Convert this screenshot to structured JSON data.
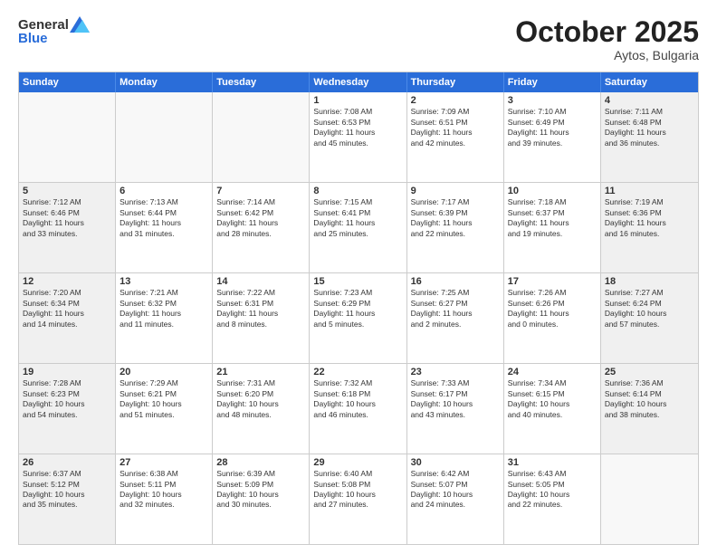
{
  "header": {
    "logo_general": "General",
    "logo_blue": "Blue",
    "month_title": "October 2025",
    "location": "Aytos, Bulgaria"
  },
  "days_of_week": [
    "Sunday",
    "Monday",
    "Tuesday",
    "Wednesday",
    "Thursday",
    "Friday",
    "Saturday"
  ],
  "weeks": [
    [
      {
        "day": "",
        "text": "",
        "empty": true
      },
      {
        "day": "",
        "text": "",
        "empty": true
      },
      {
        "day": "",
        "text": "",
        "empty": true
      },
      {
        "day": "1",
        "text": "Sunrise: 7:08 AM\nSunset: 6:53 PM\nDaylight: 11 hours\nand 45 minutes.",
        "empty": false
      },
      {
        "day": "2",
        "text": "Sunrise: 7:09 AM\nSunset: 6:51 PM\nDaylight: 11 hours\nand 42 minutes.",
        "empty": false
      },
      {
        "day": "3",
        "text": "Sunrise: 7:10 AM\nSunset: 6:49 PM\nDaylight: 11 hours\nand 39 minutes.",
        "empty": false
      },
      {
        "day": "4",
        "text": "Sunrise: 7:11 AM\nSunset: 6:48 PM\nDaylight: 11 hours\nand 36 minutes.",
        "empty": false
      }
    ],
    [
      {
        "day": "5",
        "text": "Sunrise: 7:12 AM\nSunset: 6:46 PM\nDaylight: 11 hours\nand 33 minutes.",
        "empty": false
      },
      {
        "day": "6",
        "text": "Sunrise: 7:13 AM\nSunset: 6:44 PM\nDaylight: 11 hours\nand 31 minutes.",
        "empty": false
      },
      {
        "day": "7",
        "text": "Sunrise: 7:14 AM\nSunset: 6:42 PM\nDaylight: 11 hours\nand 28 minutes.",
        "empty": false
      },
      {
        "day": "8",
        "text": "Sunrise: 7:15 AM\nSunset: 6:41 PM\nDaylight: 11 hours\nand 25 minutes.",
        "empty": false
      },
      {
        "day": "9",
        "text": "Sunrise: 7:17 AM\nSunset: 6:39 PM\nDaylight: 11 hours\nand 22 minutes.",
        "empty": false
      },
      {
        "day": "10",
        "text": "Sunrise: 7:18 AM\nSunset: 6:37 PM\nDaylight: 11 hours\nand 19 minutes.",
        "empty": false
      },
      {
        "day": "11",
        "text": "Sunrise: 7:19 AM\nSunset: 6:36 PM\nDaylight: 11 hours\nand 16 minutes.",
        "empty": false
      }
    ],
    [
      {
        "day": "12",
        "text": "Sunrise: 7:20 AM\nSunset: 6:34 PM\nDaylight: 11 hours\nand 14 minutes.",
        "empty": false
      },
      {
        "day": "13",
        "text": "Sunrise: 7:21 AM\nSunset: 6:32 PM\nDaylight: 11 hours\nand 11 minutes.",
        "empty": false
      },
      {
        "day": "14",
        "text": "Sunrise: 7:22 AM\nSunset: 6:31 PM\nDaylight: 11 hours\nand 8 minutes.",
        "empty": false
      },
      {
        "day": "15",
        "text": "Sunrise: 7:23 AM\nSunset: 6:29 PM\nDaylight: 11 hours\nand 5 minutes.",
        "empty": false
      },
      {
        "day": "16",
        "text": "Sunrise: 7:25 AM\nSunset: 6:27 PM\nDaylight: 11 hours\nand 2 minutes.",
        "empty": false
      },
      {
        "day": "17",
        "text": "Sunrise: 7:26 AM\nSunset: 6:26 PM\nDaylight: 11 hours\nand 0 minutes.",
        "empty": false
      },
      {
        "day": "18",
        "text": "Sunrise: 7:27 AM\nSunset: 6:24 PM\nDaylight: 10 hours\nand 57 minutes.",
        "empty": false
      }
    ],
    [
      {
        "day": "19",
        "text": "Sunrise: 7:28 AM\nSunset: 6:23 PM\nDaylight: 10 hours\nand 54 minutes.",
        "empty": false
      },
      {
        "day": "20",
        "text": "Sunrise: 7:29 AM\nSunset: 6:21 PM\nDaylight: 10 hours\nand 51 minutes.",
        "empty": false
      },
      {
        "day": "21",
        "text": "Sunrise: 7:31 AM\nSunset: 6:20 PM\nDaylight: 10 hours\nand 48 minutes.",
        "empty": false
      },
      {
        "day": "22",
        "text": "Sunrise: 7:32 AM\nSunset: 6:18 PM\nDaylight: 10 hours\nand 46 minutes.",
        "empty": false
      },
      {
        "day": "23",
        "text": "Sunrise: 7:33 AM\nSunset: 6:17 PM\nDaylight: 10 hours\nand 43 minutes.",
        "empty": false
      },
      {
        "day": "24",
        "text": "Sunrise: 7:34 AM\nSunset: 6:15 PM\nDaylight: 10 hours\nand 40 minutes.",
        "empty": false
      },
      {
        "day": "25",
        "text": "Sunrise: 7:36 AM\nSunset: 6:14 PM\nDaylight: 10 hours\nand 38 minutes.",
        "empty": false
      }
    ],
    [
      {
        "day": "26",
        "text": "Sunrise: 6:37 AM\nSunset: 5:12 PM\nDaylight: 10 hours\nand 35 minutes.",
        "empty": false
      },
      {
        "day": "27",
        "text": "Sunrise: 6:38 AM\nSunset: 5:11 PM\nDaylight: 10 hours\nand 32 minutes.",
        "empty": false
      },
      {
        "day": "28",
        "text": "Sunrise: 6:39 AM\nSunset: 5:09 PM\nDaylight: 10 hours\nand 30 minutes.",
        "empty": false
      },
      {
        "day": "29",
        "text": "Sunrise: 6:40 AM\nSunset: 5:08 PM\nDaylight: 10 hours\nand 27 minutes.",
        "empty": false
      },
      {
        "day": "30",
        "text": "Sunrise: 6:42 AM\nSunset: 5:07 PM\nDaylight: 10 hours\nand 24 minutes.",
        "empty": false
      },
      {
        "day": "31",
        "text": "Sunrise: 6:43 AM\nSunset: 5:05 PM\nDaylight: 10 hours\nand 22 minutes.",
        "empty": false
      },
      {
        "day": "",
        "text": "",
        "empty": true
      }
    ]
  ]
}
